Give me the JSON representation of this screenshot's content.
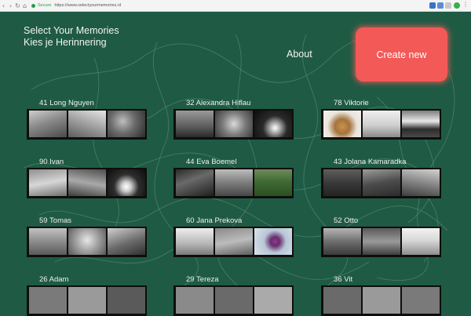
{
  "browser": {
    "secure_label": "Secure",
    "url": "https://www.selectyourmemories.nl"
  },
  "site": {
    "title_en": "Select Your Memories",
    "title_nl": "Kies je Herinnering"
  },
  "nav": {
    "about_label": "About",
    "create_label": "Create new"
  },
  "accent_color": "#f25957",
  "background_color": "#1f5b44",
  "memories": [
    {
      "label": "41 Long Nguyen"
    },
    {
      "label": "32 Alexandra Hiflau"
    },
    {
      "label": "78 Viktorie"
    },
    {
      "label": "90 Ivan"
    },
    {
      "label": "44 Eva Boemel"
    },
    {
      "label": "43 Jolana Kamaradka"
    },
    {
      "label": "59 Tomas"
    },
    {
      "label": "60 Jana Prekova"
    },
    {
      "label": "52 Otto"
    },
    {
      "label": "26 Adam"
    },
    {
      "label": "29 Tereza"
    },
    {
      "label": "36 Vit"
    }
  ]
}
